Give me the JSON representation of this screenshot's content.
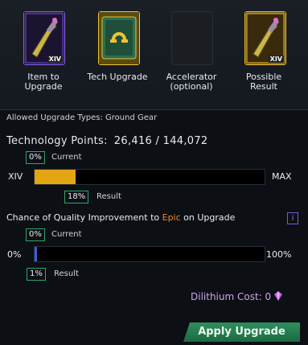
{
  "slots": [
    {
      "label": "Item to Upgrade",
      "tier": "XIV",
      "icon": "ground-gear-weapon-icon"
    },
    {
      "label": "Tech Upgrade",
      "icon": "tech-upgrade-icon"
    },
    {
      "label": "Accelerator (optional)",
      "icon": "empty-slot-icon"
    },
    {
      "label": "Possible Result",
      "tier": "XIV",
      "icon": "ground-gear-weapon-icon"
    }
  ],
  "allowed_types": "Allowed Upgrade Types: Ground Gear",
  "tech_points": {
    "label": "Technology Points:",
    "value": "26,416 / 144,072",
    "current_pct_label": "0%",
    "current_label": "Current",
    "result_pct_label": "18%",
    "result_label": "Result",
    "min_label": "XIV",
    "max_label": "MAX",
    "current_fraction": 0.0,
    "result_fraction": 0.18,
    "fill_color": "#e3a514"
  },
  "quality": {
    "prefix": "Chance of Quality Improvement to ",
    "rarity": "Epic",
    "suffix": " on Upgrade",
    "info_label": "i",
    "current_pct_label": "0%",
    "current_label": "Current",
    "result_pct_label": "1%",
    "result_label": "Result",
    "min_label": "0%",
    "max_label": "100%",
    "current_fraction": 0.0,
    "result_fraction": 0.01,
    "fill_color": "#3a5fd9",
    "rarity_color": "#e68a2c"
  },
  "dilithium": {
    "label": "Dilithium Cost:",
    "value": "0",
    "icon": "dilithium-icon"
  },
  "apply_button": "Apply Upgrade"
}
